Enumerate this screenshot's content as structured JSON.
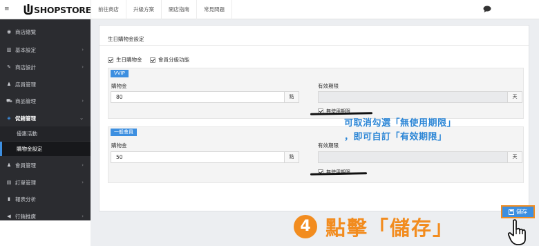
{
  "header": {
    "menu_toggle": "≡",
    "logo_text": "SHOPSTORE",
    "nav": [
      "前往商店",
      "升級方案",
      "開店指南",
      "常見問題"
    ],
    "chat_icon": "chat-bubble-icon"
  },
  "sidebar": {
    "items": [
      {
        "icon": "dashboard-icon",
        "glyph": "◉",
        "label": "商店總覽",
        "chevron": ""
      },
      {
        "icon": "bank-icon",
        "glyph": "▥",
        "label": "基本設定",
        "chevron": "›"
      },
      {
        "icon": "brush-icon",
        "glyph": "✎",
        "label": "商店設計",
        "chevron": "›"
      },
      {
        "icon": "user-icon",
        "glyph": "♟",
        "label": "店員管理",
        "chevron": ""
      },
      {
        "icon": "cart-icon",
        "glyph": "⛟",
        "label": "商品管理",
        "chevron": "›"
      },
      {
        "icon": "gift-icon",
        "glyph": "◈",
        "label": "促銷管理",
        "chevron": "⌄"
      },
      {
        "icon": "users-icon",
        "glyph": "♟",
        "label": "會員管理",
        "chevron": "›"
      },
      {
        "icon": "order-icon",
        "glyph": "▤",
        "label": "訂單管理",
        "chevron": "›"
      },
      {
        "icon": "chart-icon",
        "glyph": "▮",
        "label": "報表分析",
        "chevron": ""
      },
      {
        "icon": "megaphone-icon",
        "glyph": "◀",
        "label": "行銷推廣",
        "chevron": "›"
      }
    ],
    "sub_items": [
      "優惠活動",
      "購物金設定"
    ]
  },
  "main": {
    "card_title": "生日購物金設定",
    "checkboxes": [
      "生日購物金",
      "會員分級功能"
    ],
    "tiers": [
      {
        "tag": "VVIP",
        "amount_label": "購物金",
        "amount_value": "80",
        "amount_unit": "點",
        "expiry_label": "有效期限",
        "expiry_unit": "天",
        "unused_label": "無使用期限"
      },
      {
        "tag": "一般會員",
        "amount_label": "購物金",
        "amount_value": "50",
        "amount_unit": "點",
        "expiry_label": "有效期限",
        "expiry_unit": "天",
        "unused_label": "無使用期限"
      }
    ]
  },
  "annotations": {
    "callout_line1": "可取消勾選「無使用期限」",
    "callout_line2": "，即可自訂「有效期限」",
    "step_number": "4",
    "step_text": "點擊「儲存」"
  },
  "save_button": {
    "label": "儲存",
    "icon": "save-icon"
  },
  "colors": {
    "accent": "#3d8fe0",
    "highlight": "#f28c1f",
    "sidebar_bg": "#2b2c30",
    "callout": "#2c86d6"
  }
}
